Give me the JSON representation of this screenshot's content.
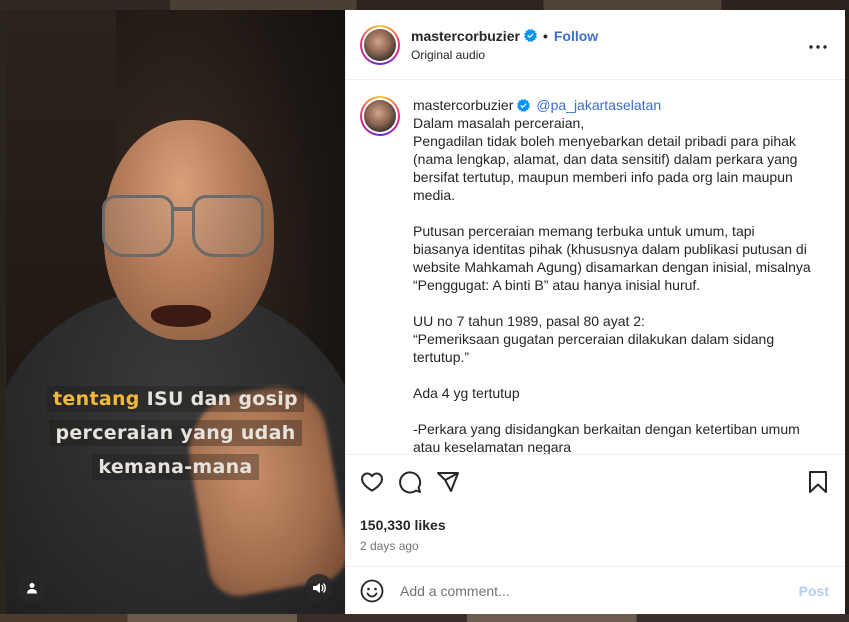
{
  "post": {
    "author": {
      "username": "mastercorbuzier",
      "verified": true,
      "follow_label": "Follow",
      "separator": "•",
      "audio": "Original audio"
    },
    "caption": {
      "username": "mastercorbuzier",
      "mention": "@pa_jakartaselatan",
      "paragraphs": [
        "Dalam masalah perceraian,\nPengadilan tidak boleh menyebarkan detail pribadi para pihak (nama lengkap, alamat, dan data sensitif) dalam perkara yang bersifat tertutup, maupun memberi info pada org lain maupun media.",
        "Putusan perceraian memang terbuka untuk umum, tapi biasanya identitas pihak (khususnya dalam publikasi putusan di website Mahkamah Agung) disamarkan dengan inisial, misalnya “Penggugat: A binti B” atau hanya inisial huruf.",
        "UU no 7 tahun 1989, pasal 80 ayat 2:\n“Pemeriksaan gugatan perceraian dilakukan dalam sidang tertutup.”",
        "Ada 4 yg tertutup",
        "-Perkara yang disidangkan berkaitan dengan ketertiban umum atau keselamatan negara"
      ]
    },
    "likes": "150,330 likes",
    "date": "2 days ago",
    "comment_placeholder": "Add a comment...",
    "post_label": "Post"
  },
  "video": {
    "subtitle": {
      "line1_highlight": "tentang",
      "line1_rest": " ISU dan gosip",
      "line2": "perceraian yang udah",
      "line3": "kemana-mana"
    },
    "highlight_color": "#f1b93a"
  },
  "icons": {
    "verified": "verified-badge-icon",
    "more": "more-options-icon",
    "like": "heart-icon",
    "comment": "comment-icon",
    "share": "share-icon",
    "save": "bookmark-icon",
    "emoji": "emoji-icon",
    "user": "user-tag-icon",
    "sound": "sound-icon"
  },
  "colors": {
    "link": "#3c6fc9",
    "post_disabled": "#b2cdf3",
    "verified": "#0095f6"
  }
}
